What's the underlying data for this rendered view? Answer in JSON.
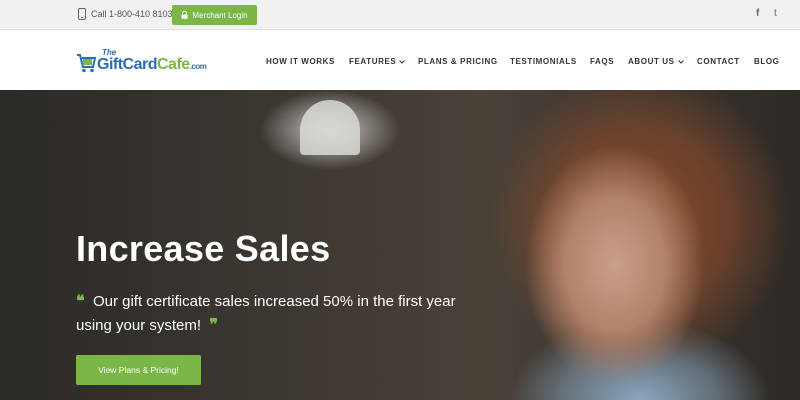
{
  "topbar": {
    "phone": "Call 1-800-410 8103",
    "merchant_login": "Merchant Login",
    "social": {
      "facebook": "f",
      "twitter": "t"
    }
  },
  "logo": {
    "the": "The",
    "gift": "GiftCard",
    "cafe": "Cafe",
    "com": ".com"
  },
  "nav": {
    "how_it_works": "HOW IT WORKS",
    "features": "FEATURES",
    "plans_pricing": "PLANS & PRICING",
    "testimonials": "TESTIMONIALS",
    "faqs": "FAQS",
    "about_us": "ABOUT US",
    "contact": "CONTACT",
    "blog": "BLOG"
  },
  "hero": {
    "headline": "Increase Sales",
    "open_quote": "❝",
    "quote": "Our gift certificate sales increased 50% in the first year using your system!",
    "close_quote": "❞",
    "cta": "View Plans & Pricing!"
  },
  "colors": {
    "accent": "#7ab648",
    "brand_blue": "#2a6db5"
  }
}
